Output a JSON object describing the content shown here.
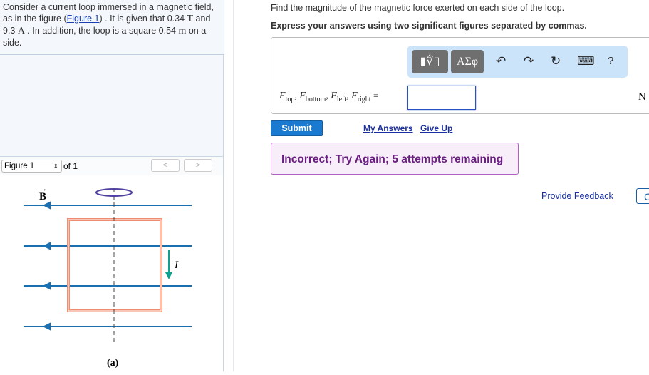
{
  "problem": {
    "text_before": "Consider a current loop immersed in a magnetic field, as in the figure (",
    "figure_link": "Figure 1",
    "text_mid": ") . It is given that ",
    "B": "0.34",
    "B_unit": "T",
    "and": " and ",
    "I": "9.3",
    "I_unit": "A",
    "text_after": ". In addition, the loop is a square ",
    "side": "0.54",
    "side_unit": "m",
    "end": " on a side."
  },
  "figure_nav": {
    "select": "Figure 1",
    "of": "of 1",
    "prev": "<",
    "next": ">"
  },
  "figure": {
    "field_label": "B",
    "current_label": "I",
    "caption": "(a)"
  },
  "question": {
    "prompt": "Find the magnitude of the magnetic force exerted on each side of the loop.",
    "instruction": "Express your answers using two significant figures separated by commas."
  },
  "toolbar": {
    "templates": "▮∜▯",
    "greek": "ΑΣφ",
    "undo": "↶",
    "redo": "↷",
    "reset": "↻",
    "keyboard": "⌨",
    "help": "?"
  },
  "answer": {
    "F": "F",
    "subs": [
      "top",
      "bottom",
      "left",
      "right"
    ],
    "equals": "=",
    "value": "",
    "unit": "N"
  },
  "actions": {
    "submit": "Submit",
    "my_answers": "My Answers",
    "give_up": "Give Up"
  },
  "feedback": {
    "message": "Incorrect; Try Again; 5 attempts remaining",
    "provide": "Provide Feedback",
    "continue": "C"
  }
}
